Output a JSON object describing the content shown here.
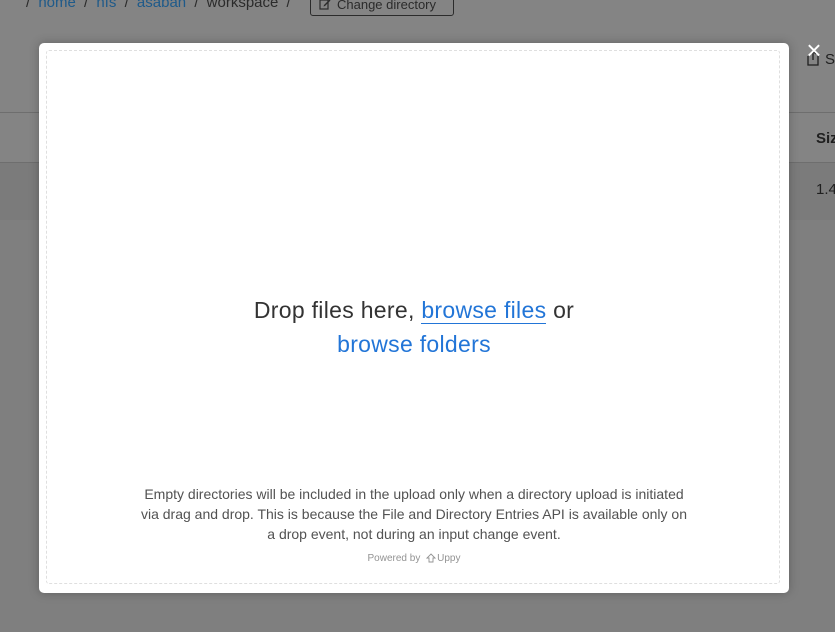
{
  "breadcrumb": {
    "items": [
      "home",
      "nfs",
      "asaban",
      "workspace"
    ],
    "separator": "/"
  },
  "toolbar": {
    "change_directory_label": "Change directory",
    "share_partial": "S"
  },
  "table": {
    "size_header_partial": "Siz",
    "row_size_partial": "1.4"
  },
  "uploader": {
    "drop_prefix": "Drop files here, ",
    "browse_files": "browse files",
    "or": " or",
    "browse_folders": "browse folders",
    "note": "Empty directories will be included in the upload only when a directory upload is initiated via drag and drop. This is because the File and Directory Entries API is available only on a drop event, not during an input change event.",
    "powered_by": "Powered by",
    "brand": "Uppy",
    "close_symbol": "×"
  },
  "colors": {
    "accent": "#2275d7",
    "overlay": "#7f7f7f"
  }
}
